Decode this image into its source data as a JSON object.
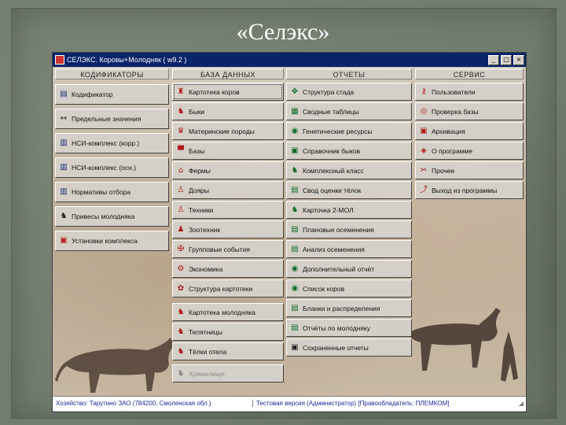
{
  "slide": {
    "title": "«Селэкс»"
  },
  "window": {
    "title": "СЕЛЭКС. Коровы+Молодняк ( w9.2 )",
    "minimize_label": "_",
    "maximize_label": "□",
    "close_label": "×"
  },
  "columns": [
    {
      "header": "КОДИФИКАТОРЫ",
      "buttons": [
        {
          "label": "Кодификатор",
          "icon": "table-edit-icon"
        },
        {
          "label": "Предельные значения",
          "icon": "range-icon"
        },
        {
          "label": "НСИ-комплекс (корр.)",
          "icon": "book-icon"
        },
        {
          "label": "НСИ-комплекс (осн.)",
          "icon": "book-icon"
        },
        {
          "label": "Нормативы отбора",
          "icon": "book-icon"
        },
        {
          "label": "Привесы молодняка",
          "icon": "calf-icon"
        },
        {
          "label": "Установки комплекса",
          "icon": "settings-icon"
        }
      ]
    },
    {
      "header": "БАЗА ДАННЫХ",
      "buttons": [
        {
          "label": "Картотека коров",
          "icon": "cow-card-icon"
        },
        {
          "label": "Быки",
          "icon": "bull-icon"
        },
        {
          "label": "Материнские породы",
          "icon": "breed-icon"
        },
        {
          "label": "Базы",
          "icon": "base-icon"
        },
        {
          "label": "Фермы",
          "icon": "farm-icon"
        },
        {
          "label": "Дояры",
          "icon": "milker-icon"
        },
        {
          "label": "Техники",
          "icon": "technician-icon"
        },
        {
          "label": "Зоотехник",
          "icon": "zootechnician-icon"
        },
        {
          "label": "Групповые события",
          "icon": "group-events-icon"
        },
        {
          "label": "Экономика",
          "icon": "economy-icon"
        },
        {
          "label": "Структура картотеки",
          "icon": "structure-icon"
        },
        {
          "label": "Картотека молодняка",
          "icon": "young-card-icon"
        },
        {
          "label": "Телятницы",
          "icon": "calf-barn-icon"
        },
        {
          "label": "Тёлки отела",
          "icon": "heifer-icon"
        },
        {
          "label": "Хранилище",
          "icon": "storage-icon"
        }
      ]
    },
    {
      "header": "ОТЧЕТЫ",
      "buttons": [
        {
          "label": "Структура стада",
          "icon": "herd-structure-icon"
        },
        {
          "label": "Сводные таблицы",
          "icon": "pivot-table-icon"
        },
        {
          "label": "Генетические ресурсы",
          "icon": "genetics-icon"
        },
        {
          "label": "Справочник быков",
          "icon": "bull-directory-icon"
        },
        {
          "label": "Комплексный класс",
          "icon": "complex-class-icon"
        },
        {
          "label": "Свод оценки тёлок",
          "icon": "summary-icon"
        },
        {
          "label": "Карточка 2-МОЛ",
          "icon": "card-icon"
        },
        {
          "label": "Плановые осеменения",
          "icon": "plan-icon"
        },
        {
          "label": "Анализ осеменения",
          "icon": "analysis-icon"
        },
        {
          "label": "Дополнительный отчёт",
          "icon": "extra-report-icon"
        },
        {
          "label": "Список коров",
          "icon": "list-icon"
        },
        {
          "label": "Бланки и распределения",
          "icon": "forms-icon"
        },
        {
          "label": "Отчёты по молодняку",
          "icon": "young-report-icon"
        },
        {
          "label": "Сохраненные отчеты",
          "icon": "save-icon"
        }
      ]
    },
    {
      "header": "СЕРВИС",
      "buttons": [
        {
          "label": "Пользователи",
          "icon": "users-icon"
        },
        {
          "label": "Проверка базы",
          "icon": "check-db-icon"
        },
        {
          "label": "Архивация",
          "icon": "archive-icon"
        },
        {
          "label": "О программе",
          "icon": "about-icon"
        },
        {
          "label": "Прочее",
          "icon": "misc-icon"
        },
        {
          "label": "Выход из программы",
          "icon": "exit-icon"
        }
      ]
    }
  ],
  "status": {
    "left": "Хозяйство: Тарутино ЗАО (784200, Смоленская обл.)",
    "right": "Тестовая версия (Администратор) [Правообладатель: ПЛЕМКОМ]"
  }
}
